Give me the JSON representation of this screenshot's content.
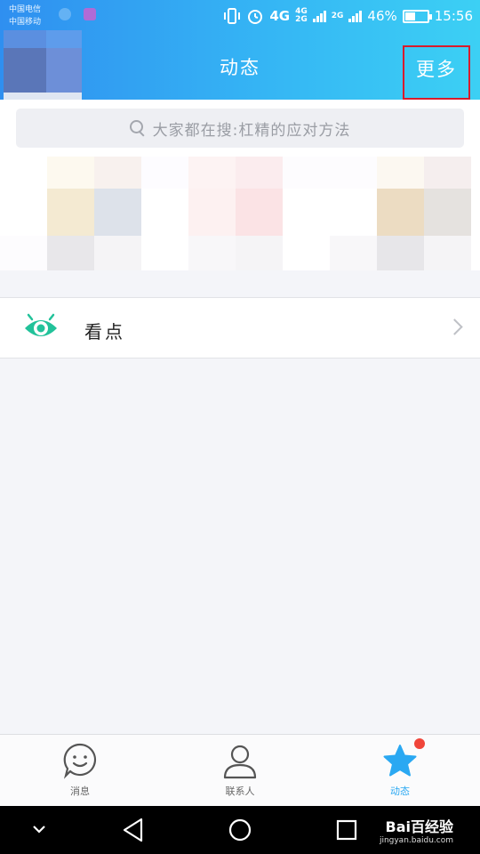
{
  "status": {
    "carrier1": "中国电信",
    "carrier2": "中国移动",
    "net_4g": "4G",
    "net_4g_small": "4G",
    "net_2g_small": "2G",
    "net_2g": "2G",
    "battery_pct": "46%",
    "battery_level": 0.46,
    "time": "15:56"
  },
  "header": {
    "title": "动态",
    "more_label": "更多"
  },
  "search": {
    "placeholder": "大家都在搜:杠精的应对方法"
  },
  "list": {
    "kandian_label": "看点"
  },
  "tabs": [
    {
      "label": "消息",
      "icon": "smile-chat-icon"
    },
    {
      "label": "联系人",
      "icon": "person-icon"
    },
    {
      "label": "动态",
      "icon": "star-icon",
      "active": true,
      "badge": true
    }
  ],
  "watermark": {
    "brand": "Bai百经验",
    "url": "jingyan.baidu.com"
  },
  "colors": {
    "header_start": "#2f8ff0",
    "header_end": "#3cd0f4",
    "accent": "#2aa8f2",
    "kandian_green": "#22c29a",
    "highlight_border": "#d81b2c",
    "badge": "#f0453a"
  }
}
